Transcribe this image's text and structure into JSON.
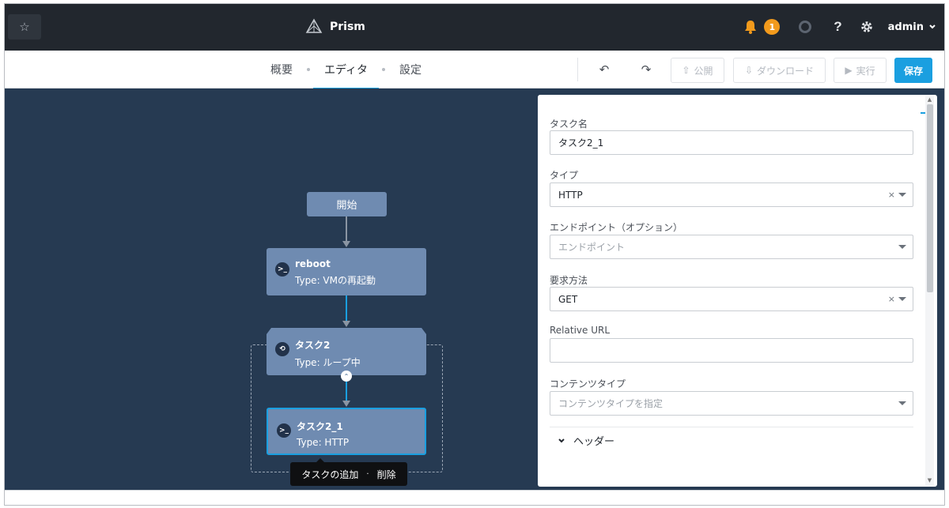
{
  "topbar": {
    "app_name": "Prism",
    "alert_count": "1",
    "user": "admin"
  },
  "tabs": [
    {
      "label": "概要"
    },
    {
      "label": "エディタ"
    },
    {
      "label": "設定"
    }
  ],
  "toolbar": {
    "publish_label": "公開",
    "download_label": "ダウンロード",
    "run_label": "実行",
    "save_label": "保存"
  },
  "workflow": {
    "start_label": "開始",
    "nodes": [
      {
        "name": "reboot",
        "type": "Type: VMの再起動"
      },
      {
        "name": "タスク2",
        "type": "Type: ループ中"
      },
      {
        "name": "タスク2_1",
        "type": "Type: HTTP"
      }
    ],
    "tooltip": {
      "add_label": "タスクの追加",
      "separator": "·",
      "delete_label": "削除"
    }
  },
  "panel": {
    "task_name_label": "タスク名",
    "task_name_value": "タスク2_1",
    "type_label": "タイプ",
    "type_value": "HTTP",
    "endpoint_label": "エンドポイント（オプション）",
    "endpoint_placeholder": "エンドポイント",
    "method_label": "要求方法",
    "method_value": "GET",
    "relative_url_label": "Relative URL",
    "relative_url_value": "",
    "content_type_label": "コンテンツタイプ",
    "content_type_placeholder": "コンテンツタイプを指定",
    "headers_label": "ヘッダー",
    "clear_glyph": "×"
  },
  "colors": {
    "accent": "#1a9fe0",
    "topbar_bg": "#22272e",
    "canvas_bg": "#263a52",
    "node_bg": "#6f8bb1",
    "alert": "#f29a1c"
  }
}
